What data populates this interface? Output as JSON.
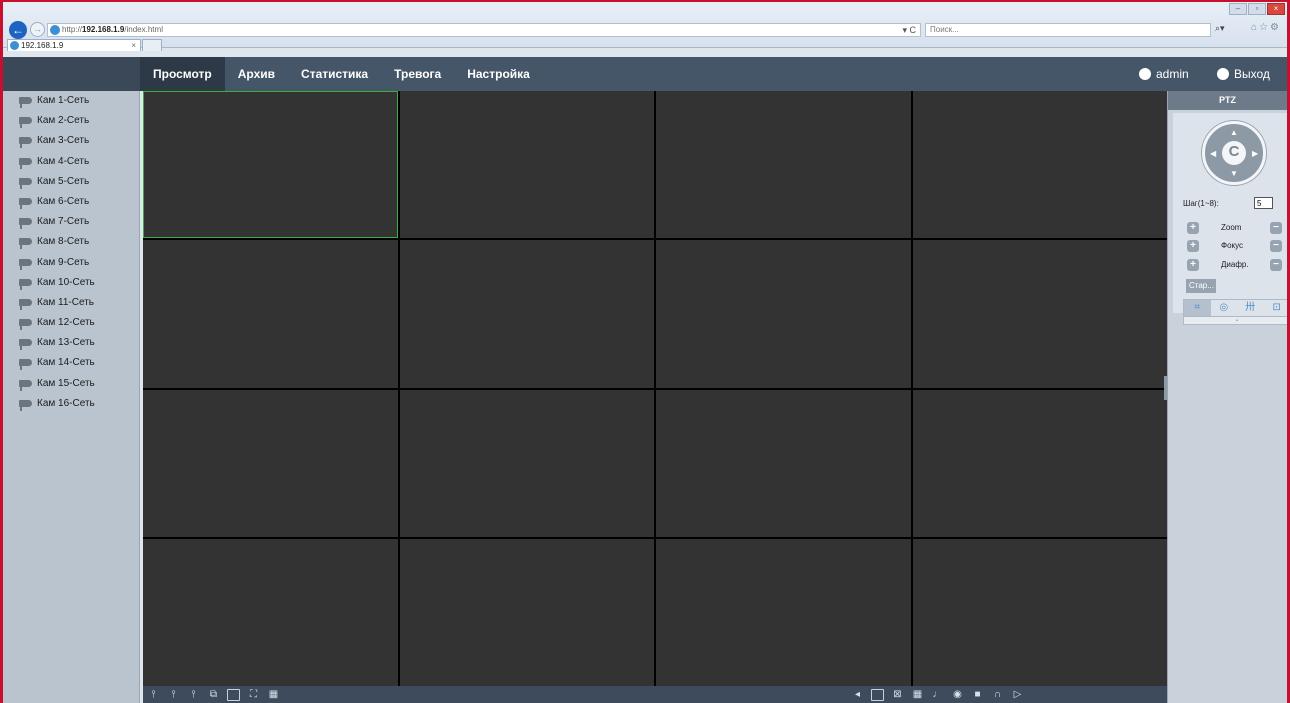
{
  "browser": {
    "url_prefix": "http://",
    "url_host": "192.168.1.9",
    "url_path": "/index.html",
    "search_placeholder": "Поиск...",
    "tab_title": "192.168.1.9",
    "refresh_glyph": "▾ C",
    "search_glyph": "⌕▾",
    "tab_close": "×"
  },
  "menu": {
    "items": [
      {
        "label": "Просмотр",
        "active": true
      },
      {
        "label": "Архив"
      },
      {
        "label": "Статистика"
      },
      {
        "label": "Тревога"
      },
      {
        "label": "Настройка"
      }
    ],
    "user": "admin",
    "logout": "Выход"
  },
  "cameras": [
    "Кам 1-Сеть",
    "Кам 2-Сеть",
    "Кам 3-Сеть",
    "Кам 4-Сеть",
    "Кам 5-Сеть",
    "Кам 6-Сеть",
    "Кам 7-Сеть",
    "Кам 8-Сеть",
    "Кам 9-Сеть",
    "Кам 10-Сеть",
    "Кам 11-Сеть",
    "Кам 12-Сеть",
    "Кам 13-Сеть",
    "Кам 14-Сеть",
    "Кам 15-Сеть",
    "Кам 16-Сеть"
  ],
  "grid": {
    "rows": 4,
    "cols": 4,
    "selected_index": 0
  },
  "ptz": {
    "title": "PTZ",
    "step_label": "Шаг(1~8):",
    "step_value": "5",
    "zoom": "Zoom",
    "focus": "Фокус",
    "iris": "Диафр.",
    "start": "Стар..."
  },
  "icons": {
    "bottom_left": [
      "stream-1-icon",
      "stream-2-icon",
      "stream-3-icon",
      "copy-icon",
      "preview-icon",
      "fullscreen-icon",
      "layout-icon"
    ],
    "bottom_right": [
      "prev-icon",
      "close-all-icon",
      "grid-icon",
      "mic-icon",
      "snapshot-icon",
      "record-icon",
      "audio-icon",
      "play-icon"
    ]
  },
  "colors": {
    "accent_green": "#3cae3c",
    "navbar": "#465669",
    "cell": "#333333",
    "browser_frame": "#c8102e"
  }
}
